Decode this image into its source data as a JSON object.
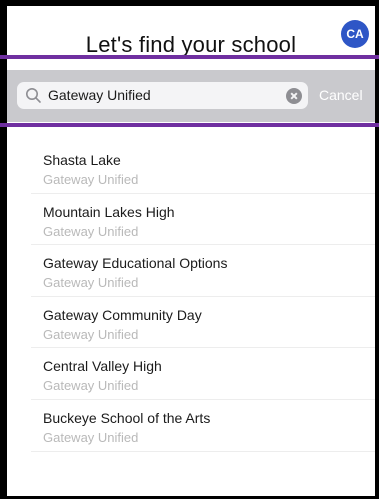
{
  "header": {
    "title": "Let's find your school",
    "avatar_initials": "CA"
  },
  "search": {
    "value": "Gateway Unified",
    "cancel_label": "Cancel"
  },
  "results": [
    {
      "name": "Shasta Lake",
      "district": "Gateway Unified"
    },
    {
      "name": "Mountain Lakes High",
      "district": "Gateway Unified"
    },
    {
      "name": "Gateway Educational Options",
      "district": "Gateway Unified"
    },
    {
      "name": "Gateway Community Day",
      "district": "Gateway Unified"
    },
    {
      "name": "Central Valley High",
      "district": "Gateway Unified"
    },
    {
      "name": "Buckeye School of the Arts",
      "district": "Gateway Unified"
    }
  ],
  "colors": {
    "avatar": "#2e56c6",
    "highlight_line": "#6f2fa0",
    "search_bar_bg": "#c9c9cd",
    "secondary_text": "#b9b9b9"
  }
}
